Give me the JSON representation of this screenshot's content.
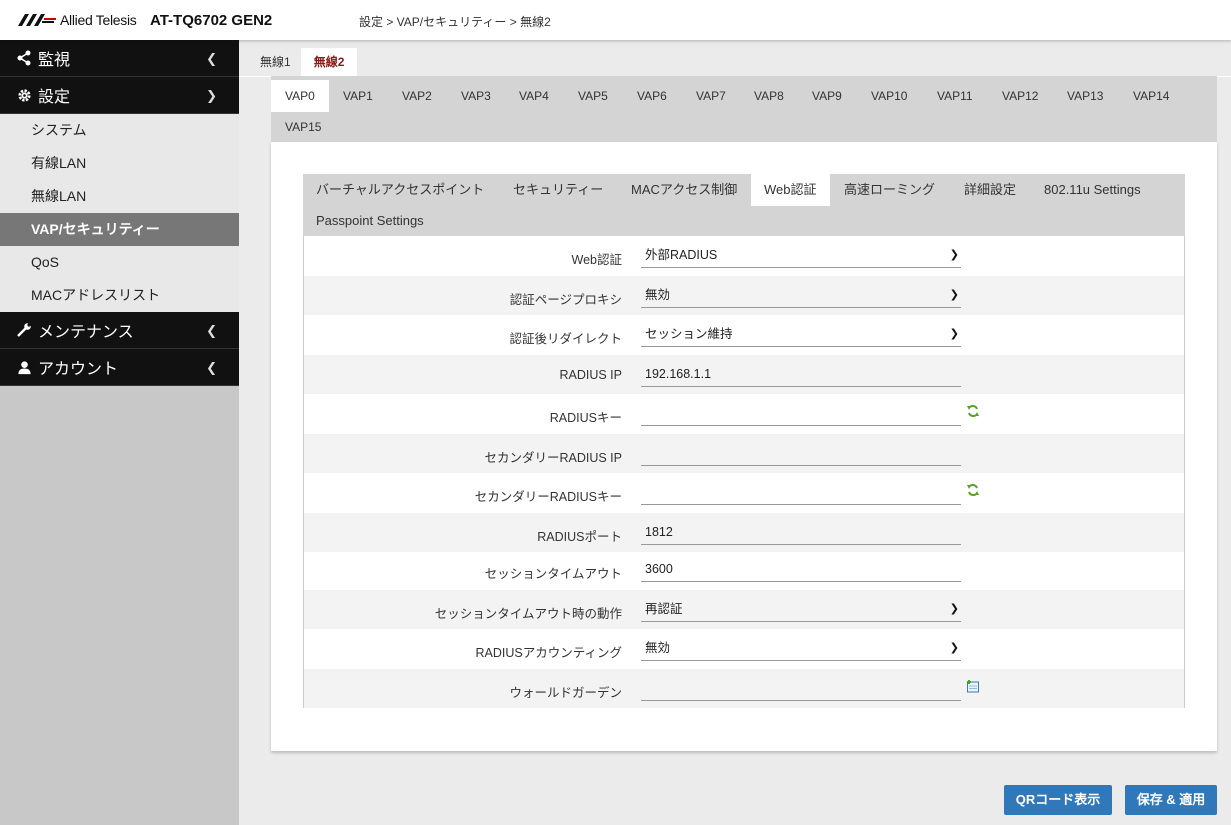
{
  "header": {
    "logo_text": "Allied Telesis",
    "model": "AT-TQ6702 GEN2",
    "breadcrumb": "設定 > VAP/セキュリティー > 無線2"
  },
  "sidebar": {
    "monitor": "監視",
    "settings": "設定",
    "settings_items": [
      "システム",
      "有線LAN",
      "無線LAN",
      "VAP/セキュリティー",
      "QoS",
      "MACアドレスリスト"
    ],
    "maintenance": "メンテナンス",
    "account": "アカウント"
  },
  "radio_tabs": [
    "無線1",
    "無線2"
  ],
  "vap_tabs": [
    "VAP0",
    "VAP1",
    "VAP2",
    "VAP3",
    "VAP4",
    "VAP5",
    "VAP6",
    "VAP7",
    "VAP8",
    "VAP9",
    "VAP10",
    "VAP11",
    "VAP12",
    "VAP13",
    "VAP14",
    "VAP15"
  ],
  "sec_tabs": [
    "バーチャルアクセスポイント",
    "セキュリティー",
    "MACアクセス制御",
    "Web認証",
    "高速ローミング",
    "詳細設定",
    "802.11u Settings",
    "Passpoint Settings"
  ],
  "form": {
    "web_auth": {
      "label": "Web認証",
      "value": "外部RADIUS"
    },
    "auth_proxy": {
      "label": "認証ページプロキシ",
      "value": "無効"
    },
    "redirect": {
      "label": "認証後リダイレクト",
      "value": "セッション維持"
    },
    "radius_ip": {
      "label": "RADIUS IP",
      "value": "192.168.1.1"
    },
    "radius_key": {
      "label": "RADIUSキー",
      "value": ""
    },
    "sec_radius_ip": {
      "label": "セカンダリーRADIUS IP",
      "value": ""
    },
    "sec_radius_key": {
      "label": "セカンダリーRADIUSキー",
      "value": ""
    },
    "radius_port": {
      "label": "RADIUSポート",
      "value": "1812"
    },
    "session_timeout": {
      "label": "セッションタイムアウト",
      "value": "3600"
    },
    "timeout_action": {
      "label": "セッションタイムアウト時の動作",
      "value": "再認証"
    },
    "accounting": {
      "label": "RADIUSアカウンティング",
      "value": "無効"
    },
    "walled_garden": {
      "label": "ウォールドガーデン",
      "value": ""
    }
  },
  "buttons": {
    "qr": "QRコード表示",
    "save": "保存 & 適用"
  },
  "colors": {
    "accent": "#2f78b9",
    "active_radio": "#8b1a1a",
    "sidebar_dark": "#111111",
    "refresh_icon": "#5aa02c"
  }
}
